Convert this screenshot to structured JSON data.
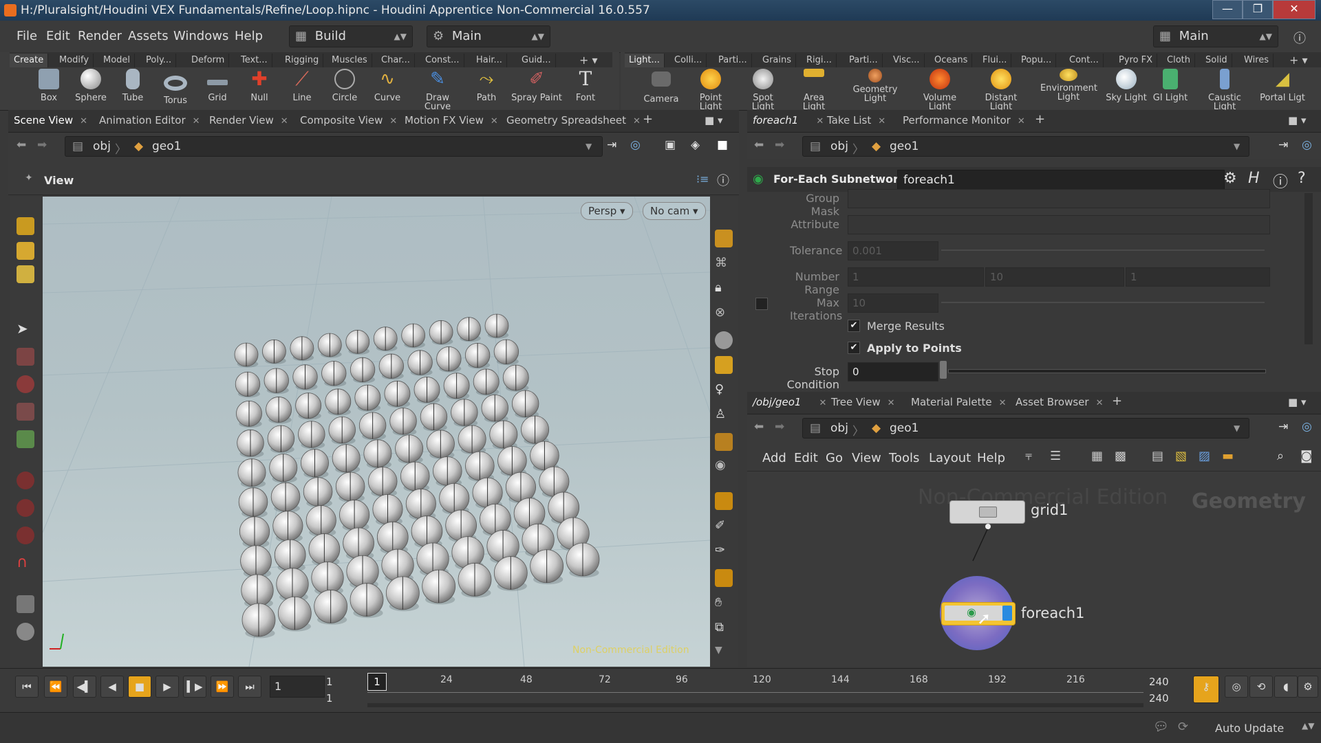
{
  "window": {
    "title": "H:/Pluralsight/Houdini VEX Fundamentals/Refine/Loop.hipnc - Houdini Apprentice Non-Commercial 16.0.557"
  },
  "menubar": {
    "items": [
      "File",
      "Edit",
      "Render",
      "Assets",
      "Windows",
      "Help"
    ],
    "desktop": "Build",
    "context": "Main",
    "right_desktop": "Main"
  },
  "shelf_left": {
    "tabs": [
      "Create",
      "Modify",
      "Model",
      "Poly...",
      "Deform",
      "Text...",
      "Rigging",
      "Muscles",
      "Char...",
      "Const...",
      "Hair...",
      "Guid..."
    ],
    "tools": [
      "Box",
      "Sphere",
      "Tube",
      "Torus",
      "Grid",
      "Null",
      "Line",
      "Circle",
      "Curve",
      "Draw Curve",
      "Path",
      "Spray Paint",
      "Font"
    ]
  },
  "shelf_right": {
    "tabs": [
      "Light...",
      "Colli...",
      "Parti...",
      "Grains",
      "Rigi...",
      "Parti...",
      "Visc...",
      "Oceans",
      "Flui...",
      "Popu...",
      "Cont...",
      "Pyro FX",
      "Cloth",
      "Solid",
      "Wires"
    ],
    "tools": [
      "Camera",
      "Point Light",
      "Spot Light",
      "Area Light",
      "Geometry Light",
      "Volume Light",
      "Distant Light",
      "Environment Light",
      "Sky Light",
      "GI Light",
      "Caustic Light",
      "Portal Ligt"
    ]
  },
  "left_pane": {
    "tabs": [
      "Scene View",
      "Animation Editor",
      "Render View",
      "Composite View",
      "Motion FX View",
      "Geometry Spreadsheet"
    ],
    "path": [
      "obj",
      "geo1"
    ],
    "view_label": "View",
    "persp": "Persp",
    "cam": "No cam",
    "watermark": "Non-Commercial Edition"
  },
  "params_pane": {
    "tabs": [
      "foreach1",
      "Take List",
      "Performance Monitor"
    ],
    "path": [
      "obj",
      "geo1"
    ],
    "node_type": "For-Each Subnetwork",
    "node_name": "foreach1",
    "rows": {
      "group_mask": "Group Mask",
      "attribute": "Attribute",
      "tolerance": {
        "label": "Tolerance",
        "value": "0.001"
      },
      "number_range": {
        "label": "Number Range",
        "values": [
          "1",
          "10",
          "1"
        ]
      },
      "max_iterations": {
        "label": "Max Iterations",
        "value": "10"
      },
      "merge_results": "Merge Results",
      "apply_to_points": "Apply to Points",
      "stop_condition": {
        "label": "Stop Condition",
        "value": "0"
      }
    }
  },
  "network_pane": {
    "tabs": [
      "/obj/geo1",
      "Tree View",
      "Material Palette",
      "Asset Browser"
    ],
    "path": [
      "obj",
      "geo1"
    ],
    "menu": [
      "Add",
      "Edit",
      "Go",
      "View",
      "Tools",
      "Layout",
      "Help"
    ],
    "watermark": "Non-Commercial Edition",
    "context_label": "Geometry",
    "nodes": [
      "grid1",
      "foreach1"
    ]
  },
  "timeline": {
    "current_frame": "1",
    "start_a": "1",
    "start_b": "1",
    "marker": "1",
    "ticks": [
      "24",
      "48",
      "72",
      "96",
      "120",
      "144",
      "168",
      "192",
      "216"
    ],
    "end_a": "240",
    "end_b": "240"
  },
  "status": {
    "auto_update": "Auto Update"
  }
}
